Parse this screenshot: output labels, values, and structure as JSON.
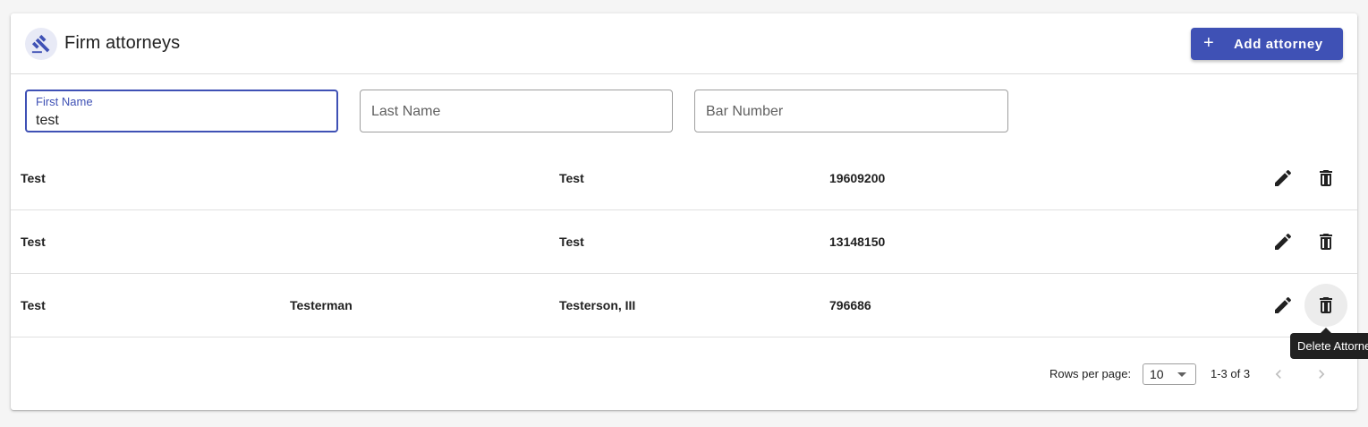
{
  "header": {
    "title": "Firm attorneys",
    "icon": "gavel-icon",
    "add_button_label": "Add attorney",
    "add_button_icon": "+"
  },
  "filters": {
    "first_name": {
      "label": "First Name",
      "value": "test"
    },
    "last_name": {
      "placeholder": "Last Name"
    },
    "bar_number": {
      "placeholder": "Bar Number"
    }
  },
  "rows": [
    {
      "first": "Test",
      "middle": "",
      "last": "Test",
      "bar": "19609200"
    },
    {
      "first": "Test",
      "middle": "",
      "last": "Test",
      "bar": "13148150"
    },
    {
      "first": "Test",
      "middle": "Testerman",
      "last": "Testerson, III",
      "bar": "796686"
    }
  ],
  "pagination": {
    "rows_per_page_label": "Rows per page:",
    "rows_per_page_value": "10",
    "range": "1-3 of 3"
  },
  "tooltip": {
    "text": "Delete Attorney"
  },
  "colors": {
    "primary": "#3f51b5",
    "primary_light": "#e8eaf6"
  }
}
